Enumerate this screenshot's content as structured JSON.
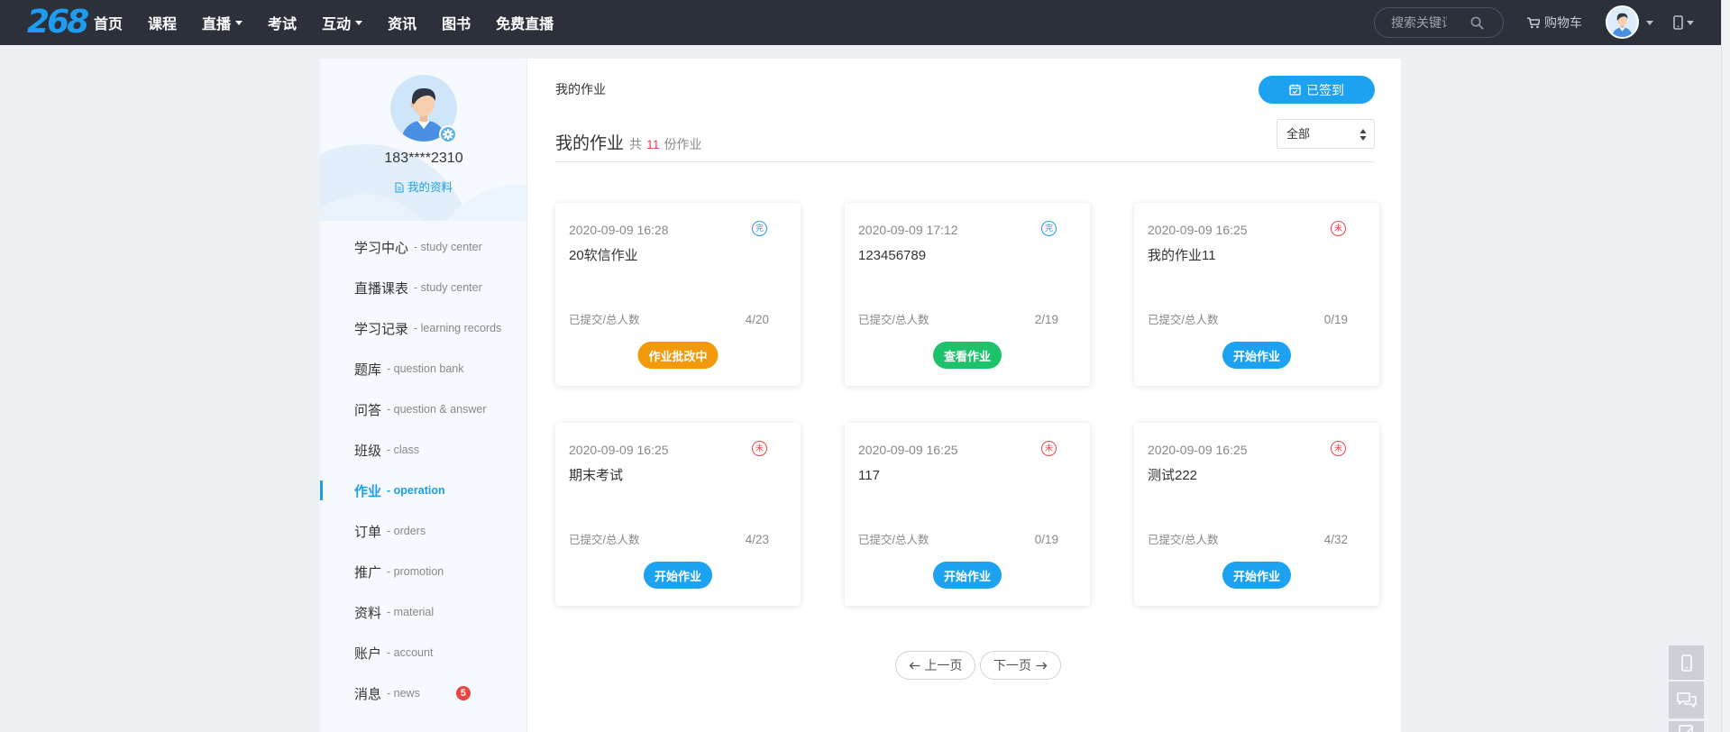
{
  "header": {
    "logo": "268",
    "nav": [
      {
        "label": "首页",
        "has_caret": false
      },
      {
        "label": "课程",
        "has_caret": false
      },
      {
        "label": "直播",
        "has_caret": true
      },
      {
        "label": "考试",
        "has_caret": false
      },
      {
        "label": "互动",
        "has_caret": true
      },
      {
        "label": "资讯",
        "has_caret": false
      },
      {
        "label": "图书",
        "has_caret": false
      },
      {
        "label": "免费直播",
        "has_caret": false
      }
    ],
    "search_placeholder": "搜索关键词",
    "cart_label": "购物车",
    "icons": [
      "search-icon",
      "cart-icon",
      "avatar",
      "chevron-down-icon",
      "phone-icon"
    ]
  },
  "profile": {
    "username": "183****2310",
    "profile_link": "我的资料"
  },
  "sidebar": {
    "menu": [
      {
        "zh": "学习中心",
        "en": "- study center",
        "active": false
      },
      {
        "zh": "直播课表",
        "en": "- study center",
        "active": false
      },
      {
        "zh": "学习记录",
        "en": "- learning records",
        "active": false
      },
      {
        "zh": "题库",
        "en": "- question bank",
        "active": false
      },
      {
        "zh": "问答",
        "en": "- question & answer",
        "active": false
      },
      {
        "zh": "班级",
        "en": "- class",
        "active": false
      },
      {
        "zh": "作业",
        "en": "- operation",
        "active": true
      },
      {
        "zh": "订单",
        "en": "- orders",
        "active": false
      },
      {
        "zh": "推广",
        "en": "- promotion",
        "active": false
      },
      {
        "zh": "资料",
        "en": "- material",
        "active": false
      },
      {
        "zh": "账户",
        "en": "- account",
        "active": false
      },
      {
        "zh": "消息",
        "en": "- news",
        "active": false,
        "badge": "5"
      }
    ]
  },
  "content": {
    "breadcrumb": "我的作业",
    "checkin_label": "已签到",
    "title": "我的作业",
    "count_prefix": "共",
    "count": "11",
    "count_suffix": "份作业",
    "filter_value": "全部",
    "card_stat_label": "已提交/总人数"
  },
  "cards": [
    {
      "date": "2020-09-09 16:28",
      "status_char": "完",
      "status_color": "#1a9fec",
      "title": "20软信作业",
      "submitted": "4/20",
      "button_label": "作业批改中",
      "button_color": "#f39a0c"
    },
    {
      "date": "2020-09-09 17:12",
      "status_char": "完",
      "status_color": "#1a9fec",
      "title": "123456789",
      "submitted": "2/19",
      "button_label": "查看作业",
      "button_color": "#1ec26b"
    },
    {
      "date": "2020-09-09 16:25",
      "status_char": "未",
      "status_color": "#e94545",
      "title": "我的作业11",
      "submitted": "0/19",
      "button_label": "开始作业",
      "button_color": "#1ca2f1"
    },
    {
      "date": "2020-09-09 16:25",
      "status_char": "未",
      "status_color": "#e94545",
      "title": "期末考试",
      "submitted": "4/23",
      "button_label": "开始作业",
      "button_color": "#1ca2f1"
    },
    {
      "date": "2020-09-09 16:25",
      "status_char": "未",
      "status_color": "#e94545",
      "title": "117",
      "submitted": "0/19",
      "button_label": "开始作业",
      "button_color": "#1ca2f1"
    },
    {
      "date": "2020-09-09 16:25",
      "status_char": "未",
      "status_color": "#e94545",
      "title": "测试222",
      "submitted": "4/32",
      "button_label": "开始作业",
      "button_color": "#1ca2f1"
    }
  ],
  "pagination": {
    "prev_label": "上一页",
    "next_label": "下一页"
  },
  "float_tools": [
    "phone-icon",
    "chat-icon",
    "feedback-icon"
  ],
  "colors": {
    "header_bg": "#2b303b",
    "accent": "#1a9fec",
    "danger": "#e94545",
    "page_bg": "#eef0f4"
  }
}
